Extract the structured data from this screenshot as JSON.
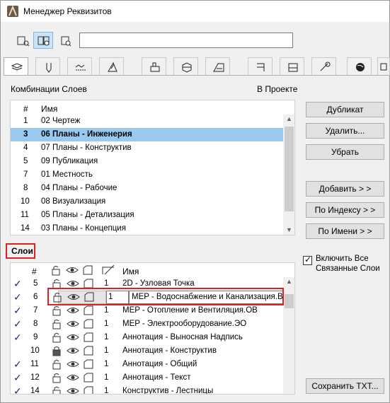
{
  "window": {
    "title": "Менеджер Реквизитов"
  },
  "top_search": {
    "value": ""
  },
  "tabs": [
    {
      "name": "layers-tab-icon"
    },
    {
      "name": "pen-tab-icon"
    },
    {
      "name": "line-types-tab-icon"
    },
    {
      "name": "fill-tab-icon"
    },
    {
      "name": "building-material-tab-icon"
    },
    {
      "name": "composite-tab-icon"
    },
    {
      "name": "profile-tab-icon"
    },
    {
      "name": "zones-tab-icon"
    },
    {
      "name": "mep-tab-icon"
    },
    {
      "name": "surface-tab-icon"
    },
    {
      "name": "globe-tab-icon"
    },
    {
      "name": "more-tab-icon"
    }
  ],
  "combos": {
    "title": "Комбинации Слоев",
    "in_project": "В Проекте",
    "headers": {
      "num": "#",
      "name": "Имя"
    },
    "rows": [
      {
        "num": "1",
        "name": "02 Чертеж"
      },
      {
        "num": "3",
        "name": "06 Планы - Инженерия",
        "selected": true
      },
      {
        "num": "4",
        "name": "07 Планы - Конструктив"
      },
      {
        "num": "5",
        "name": "09 Публикация"
      },
      {
        "num": "7",
        "name": "01 Местность"
      },
      {
        "num": "8",
        "name": "04 Планы - Рабочие"
      },
      {
        "num": "10",
        "name": "08 Визуализация"
      },
      {
        "num": "11",
        "name": "05 Планы - Детализация"
      },
      {
        "num": "14",
        "name": "03 Планы - Концепция"
      }
    ]
  },
  "buttons": {
    "duplicate": "Дубликат",
    "delete": "Удалить...",
    "remove": "Убрать",
    "add": "Добавить > >",
    "by_index": "По Индексу > >",
    "by_name": "По Имени > >",
    "save_txt": "Сохранить TXT..."
  },
  "layers": {
    "title": "Слои",
    "headers": {
      "num": "#",
      "name": "Имя"
    },
    "include_all_label": "Включить Все Связанные Слои",
    "include_all_checked": true,
    "rows": [
      {
        "checked": true,
        "num": "5",
        "pen": "1",
        "name": "2D - Узловая Точка"
      },
      {
        "checked": true,
        "num": "6",
        "pen": "1",
        "name": "MEP - Водоснабжение и Канализация.ВК",
        "editing": true
      },
      {
        "checked": true,
        "num": "7",
        "pen": "1",
        "name": "MEP - Отопление и Вентиляция.ОВ"
      },
      {
        "checked": true,
        "num": "8",
        "pen": "1",
        "name": "MEP - Электрооборудование.ЭО"
      },
      {
        "checked": true,
        "num": "9",
        "pen": "1",
        "name": "Аннотация - Выносная Надпись"
      },
      {
        "checked": false,
        "num": "10",
        "pen": "1",
        "name": "Аннотация - Конструктив",
        "locked": true
      },
      {
        "checked": true,
        "num": "11",
        "pen": "1",
        "name": "Аннотация - Общий"
      },
      {
        "checked": true,
        "num": "12",
        "pen": "1",
        "name": "Аннотация - Текст"
      },
      {
        "checked": true,
        "num": "14",
        "pen": "1",
        "name": "Конструктив - Лестницы"
      }
    ]
  }
}
